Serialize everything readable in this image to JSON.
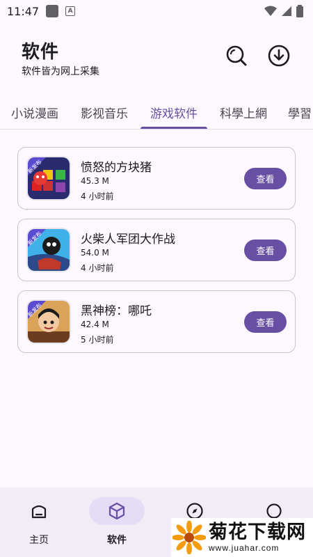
{
  "status_bar": {
    "time": "11:47",
    "a_label": "A"
  },
  "header": {
    "title": "软件",
    "subtitle": "软件皆为网上采集"
  },
  "tabs": [
    {
      "label": "小说漫画"
    },
    {
      "label": "影视音乐"
    },
    {
      "label": "游戏软件"
    },
    {
      "label": "科學上網"
    },
    {
      "label": "學習"
    }
  ],
  "active_tab": "游戏软件",
  "apps": [
    {
      "name": "愤怒的方块猪",
      "size": "45.3 M",
      "time": "4 小时前",
      "badge": "新发布",
      "button": "查看"
    },
    {
      "name": "火柴人军团大作战",
      "size": "54.0 M",
      "time": "4 小时前",
      "badge": "新发布",
      "button": "查看"
    },
    {
      "name": "黑神榜：哪吒",
      "size": "42.4 M",
      "time": "5 小时前",
      "badge": "新发布",
      "button": "查看"
    }
  ],
  "bottom_nav": [
    {
      "label": "主页",
      "icon": "home-icon"
    },
    {
      "label": "软件",
      "icon": "box-icon"
    },
    {
      "label": "",
      "icon": "compass-icon"
    },
    {
      "label": "",
      "icon": "circle-icon"
    }
  ],
  "watermark": {
    "title": "菊花下载网",
    "url": "www.juahar.com"
  },
  "colors": {
    "accent": "#6750a4",
    "background": "#fcf8fd",
    "nav_bg": "#f2ecf6"
  }
}
